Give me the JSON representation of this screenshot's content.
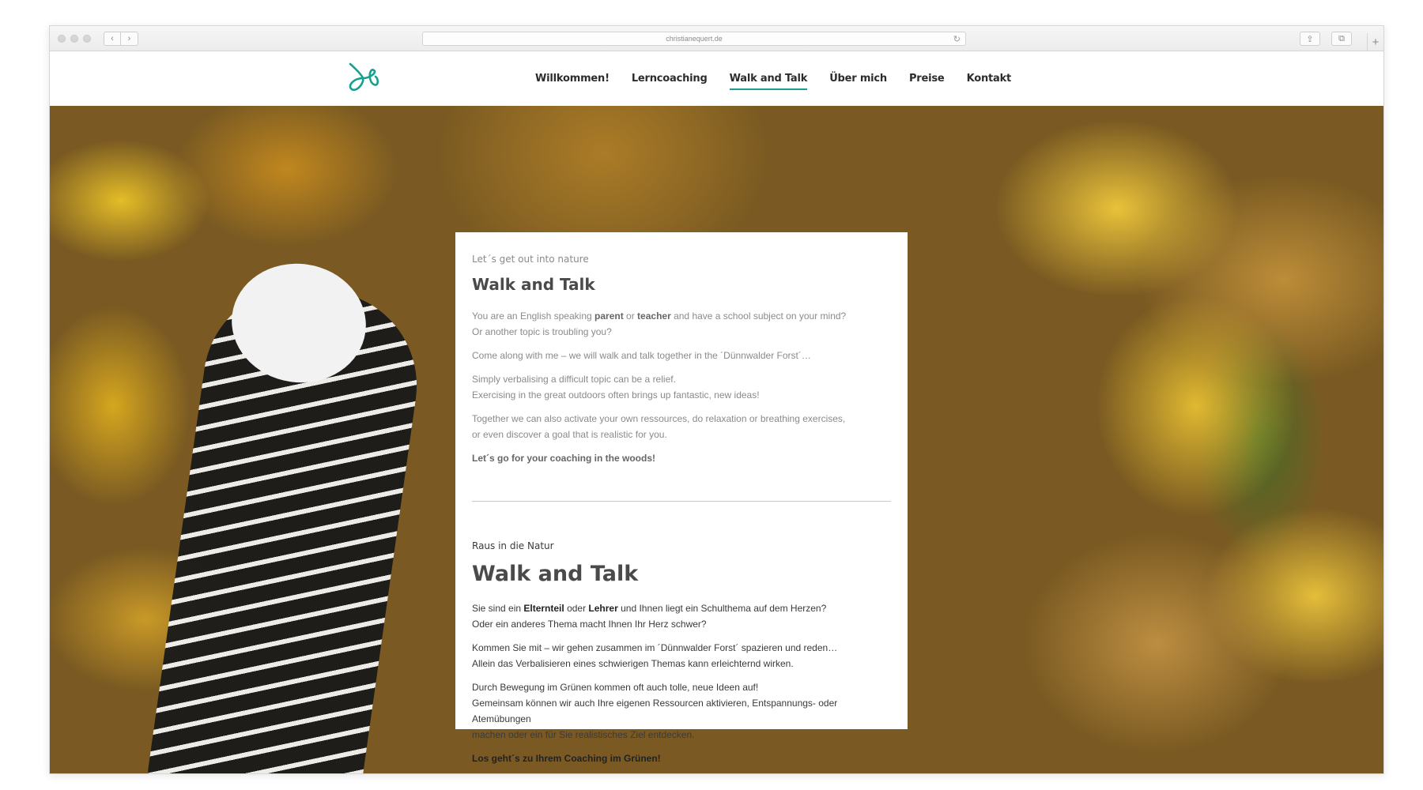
{
  "browser": {
    "url": "christianequert.de"
  },
  "site": {
    "accent_color": "#16a08f",
    "kicker_color": "#5aa628",
    "nav": [
      {
        "label": "Willkommen!",
        "active": false
      },
      {
        "label": "Lerncoaching",
        "active": false
      },
      {
        "label": "Walk and Talk",
        "active": true
      },
      {
        "label": "Über mich",
        "active": false
      },
      {
        "label": "Preise",
        "active": false
      },
      {
        "label": "Kontakt",
        "active": false
      }
    ]
  },
  "english": {
    "kicker": "Let´s get out into nature",
    "title": "Walk and Talk",
    "p1": {
      "a": "You are an English speaking ",
      "b": "parent",
      "c": " or ",
      "d": "teacher",
      "e": " and have a school subject on your mind?",
      "f": "Or another topic is troubling you?"
    },
    "p2": "Come along with me – we will walk and talk together in the ´Dünnwalder Forst´…",
    "p3a": "Simply verbalising a difficult topic can be a relief.",
    "p3b": "Exercising in the great outdoors often brings up fantastic, new ideas!",
    "p4a": "Together we can also activate your own ressources, do relaxation or breathing exercises,",
    "p4b": "or even discover a goal that is realistic for you.",
    "p5": "Let´s go for your coaching in the woods!"
  },
  "german": {
    "kicker": "Raus in die Natur",
    "title": "Walk and Talk",
    "p1": {
      "a": "Sie sind ein ",
      "b": "Elternteil",
      "c": " oder ",
      "d": "Lehrer",
      "e": " und Ihnen liegt ein Schulthema auf dem Herzen?",
      "f": "Oder ein anderes Thema macht Ihnen Ihr Herz schwer?"
    },
    "p2a": "Kommen Sie mit – wir gehen zusammen im ´Dünnwalder Forst´ spazieren und reden…",
    "p2b": "Allein das Verbalisieren eines schwierigen Themas kann erleichternd wirken.",
    "p3a": "Durch Bewegung im Grünen kommen oft auch tolle, neue Ideen auf!",
    "p3b": "Gemeinsam können wir auch Ihre eigenen Ressourcen aktivieren, Entspannungs- oder Atemübungen",
    "p3c": "machen oder ein für Sie realistisches Ziel entdecken.",
    "p4": "Los geht´s zu Ihrem Coaching im Grünen!"
  }
}
